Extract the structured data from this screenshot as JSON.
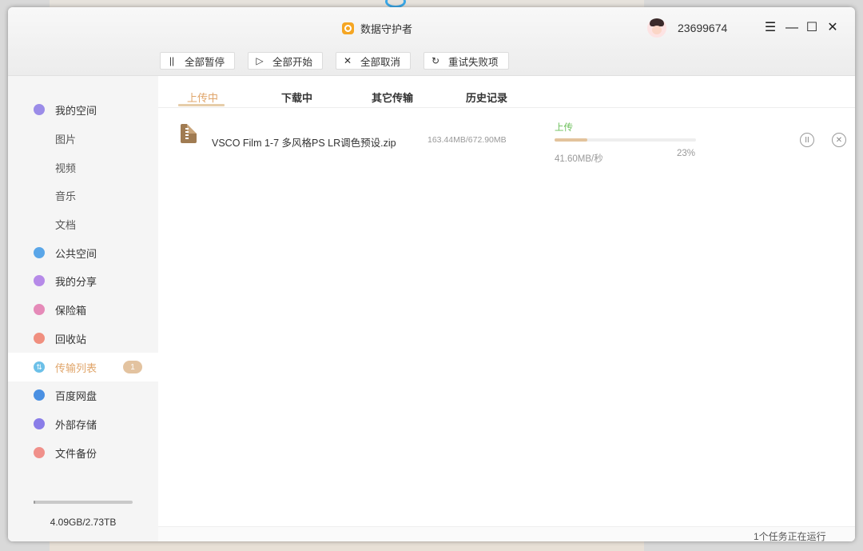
{
  "app": {
    "title": "数据守护者"
  },
  "user": {
    "id": "23699674"
  },
  "window_controls": {
    "menu": "☰",
    "minimize": "—",
    "maximize": "☐",
    "close": "✕"
  },
  "toolbar": [
    {
      "icon": "pause-icon",
      "glyph": "||",
      "label": "全部暂停"
    },
    {
      "icon": "play-icon",
      "glyph": "▷",
      "label": "全部开始"
    },
    {
      "icon": "close-icon",
      "glyph": "✕",
      "label": "全部取消"
    },
    {
      "icon": "retry-icon",
      "glyph": "↻",
      "label": "重试失败项"
    }
  ],
  "sidebar": {
    "items": [
      {
        "label": "我的空间",
        "icon": "my-space-icon",
        "color": "#9b8ce8"
      },
      {
        "label": "图片"
      },
      {
        "label": "视频"
      },
      {
        "label": "音乐"
      },
      {
        "label": "文档"
      },
      {
        "label": "公共空间",
        "icon": "public-space-icon",
        "color": "#5aa6e8"
      },
      {
        "label": "我的分享",
        "icon": "share-icon",
        "color": "#b68ae8"
      },
      {
        "label": "保险箱",
        "icon": "safe-icon",
        "color": "#e58ab8"
      },
      {
        "label": "回收站",
        "icon": "recycle-bin-icon",
        "color": "#f08f7f"
      },
      {
        "label": "传输列表",
        "icon": "transfer-icon",
        "color": "#6cc0e8",
        "badge": "1"
      },
      {
        "label": "百度网盘",
        "icon": "baidu-pan-icon",
        "color": "#4a90e2"
      },
      {
        "label": "外部存储",
        "icon": "external-storage-icon",
        "color": "#8a7de8"
      },
      {
        "label": "文件备份",
        "icon": "backup-icon",
        "color": "#f0908a"
      }
    ],
    "storage": {
      "text": "4.09GB/2.73TB",
      "fraction": 0.0015
    }
  },
  "tabs": [
    {
      "label": "上传中"
    },
    {
      "label": "下载中"
    },
    {
      "label": "其它传输"
    },
    {
      "label": "历史记录"
    }
  ],
  "transfer": {
    "file_name": "VSCO Film 1-7 多风格PS LR调色预设.zip",
    "size": "163.44MB/672.90MB",
    "status": "上传",
    "speed": "41.60MB/秒",
    "percent_label": "23%",
    "progress": 0.23
  },
  "footer": {
    "text": "1个任务正在运行"
  },
  "colors": {
    "accent": "#e0a56a",
    "status_green": "#6bbf59",
    "progress": "#e3c39c"
  }
}
